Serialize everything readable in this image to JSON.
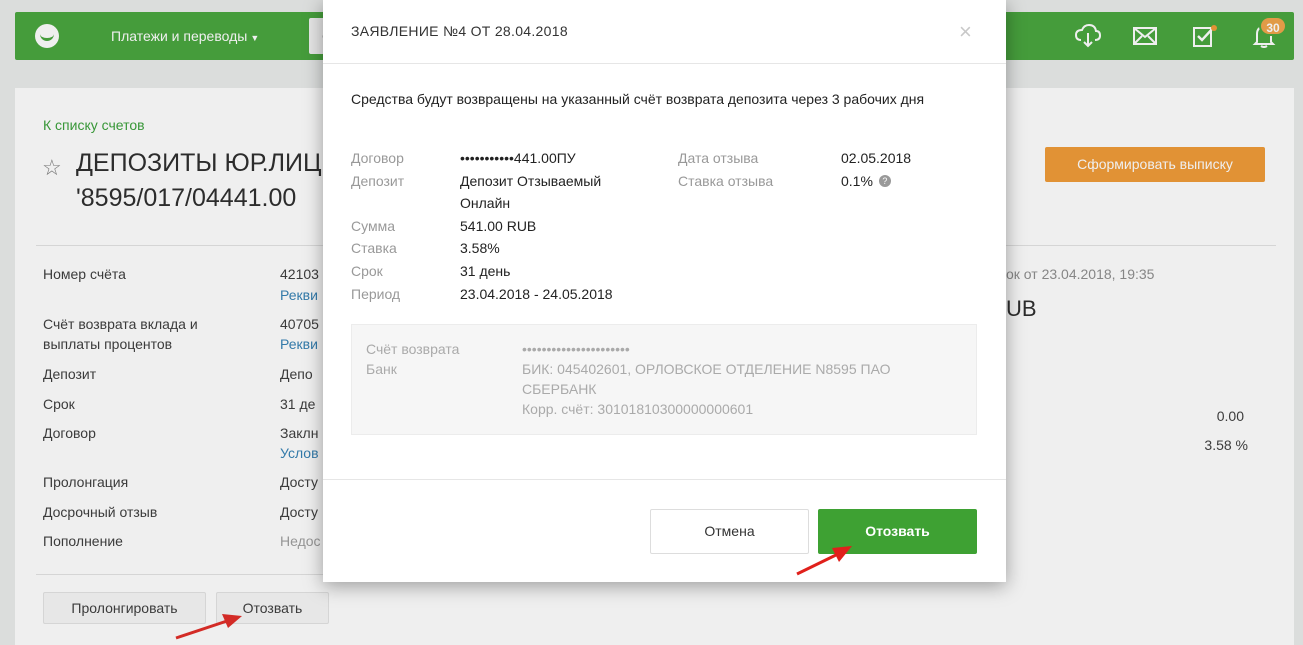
{
  "header": {
    "nav_payments": "Платежи и переводы",
    "nav_box_text": "С",
    "notifications_count": "30"
  },
  "account": {
    "back_link": "К списку счетов",
    "title_line1": "ДЕПОЗИТЫ ЮР.ЛИЦ",
    "title_line2": "'8595/017/04441.00",
    "statement_button": "Сформировать выписку",
    "fields": [
      {
        "label": "Номер счёта",
        "value": "42103",
        "sub": "Рекви"
      },
      {
        "label": "Счёт возврата вклада и",
        "label2": "выплаты процентов",
        "value": "40705",
        "sub": "Рекви"
      },
      {
        "label": "Депозит",
        "value": "Депо"
      },
      {
        "label": "Срок",
        "value": "31 де"
      },
      {
        "label": "Договор",
        "value": "Заклн",
        "sub": "Услов"
      },
      {
        "label": "Пролонгация",
        "value": "Досту"
      },
      {
        "label": "Досрочный отзыв",
        "value": "Досту"
      },
      {
        "label": "Пополнение",
        "value": "Недос"
      }
    ],
    "prolong_button": "Пролонгировать",
    "revoke_button": "Отозвать",
    "right_date": "ок от 23.04.2018, 19:35",
    "right_currency": "UB",
    "right_value1": "0.00",
    "right_value2": "3.58 %"
  },
  "modal": {
    "title": "ЗАЯВЛЕНИЕ №4 ОТ 28.04.2018",
    "message": "Средства будут возвращены на указанный счёт возврата депозита через 3 рабочих дня",
    "left": [
      {
        "label": "Договор",
        "value": "•••••••••••441.00ПУ"
      },
      {
        "label": "Депозит",
        "value": "Депозит Отзываемый",
        "value2": "Онлайн"
      },
      {
        "label": "Сумма",
        "value": "541.00 RUB"
      },
      {
        "label": "Ставка",
        "value": "3.58%"
      },
      {
        "label": "Срок",
        "value": "31 день"
      },
      {
        "label": "Период",
        "value": "23.04.2018 - 24.05.2018"
      }
    ],
    "right": [
      {
        "label": "Дата отзыва",
        "value": "02.05.2018"
      },
      {
        "label": "Ставка отзыва",
        "value": "0.1%"
      }
    ],
    "box": {
      "return_account_label": "Счёт возврата",
      "return_account_value": "••••••••••••••••••••••",
      "bank_label": "Банк",
      "bank_line1": "БИК: 045402601, ОРЛОВСКОЕ ОТДЕЛЕНИЕ N8595 ПАО",
      "bank_line2": "СБЕРБАНК",
      "bank_line3": "Корр. счёт: 30101810300000000601"
    },
    "cancel_button": "Отмена",
    "revoke_button": "Отозвать"
  },
  "colors": {
    "brand_green": "#3ea133",
    "accent_orange": "#f0962c",
    "arrow_red": "#e0201b"
  }
}
